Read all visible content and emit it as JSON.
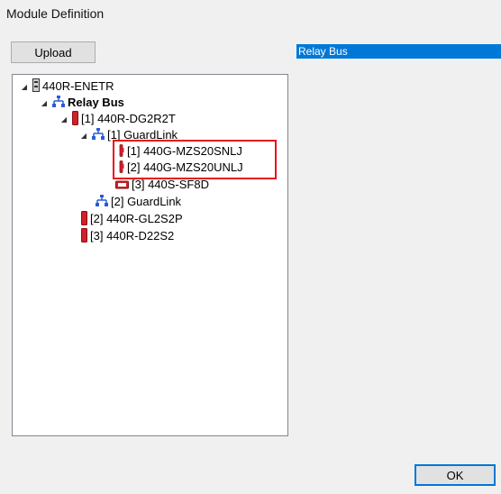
{
  "window": {
    "title": "Module Definition"
  },
  "toolbar": {
    "upload_label": "Upload"
  },
  "detail": {
    "selected_label": "Relay Bus"
  },
  "tree": {
    "root": "440R-ENETR",
    "bus": "Relay Bus",
    "module1": "[1] 440R-DG2R2T",
    "guardlink1": "[1] GuardLink",
    "device1": "[1] 440G-MZS20SNLJ",
    "device2": "[2] 440G-MZS20UNLJ",
    "device3": "[3] 440S-SF8D",
    "guardlink2": "[2] GuardLink",
    "module2": "[2] 440R-GL2S2P",
    "module3": "[3] 440R-D22S2"
  },
  "footer": {
    "ok_label": "OK"
  },
  "colors": {
    "selection": "#0078d7",
    "highlight": "#e8141c",
    "module_red": "#d0202a",
    "network_blue": "#2a5bd7"
  }
}
